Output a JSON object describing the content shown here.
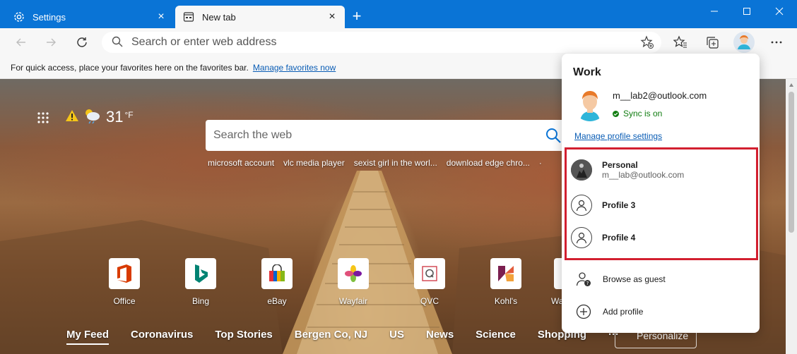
{
  "tabs": [
    {
      "label": "Settings",
      "icon": "gear-icon"
    },
    {
      "label": "New tab",
      "icon": "newtab-icon"
    }
  ],
  "address_bar": {
    "placeholder": "Search or enter web address"
  },
  "favorites_bar": {
    "message": "For quick access, place your favorites here on the favorites bar.",
    "link": "Manage favorites now"
  },
  "weather": {
    "temperature": "31",
    "unit": "°F"
  },
  "page_search": {
    "placeholder": "Search the web"
  },
  "suggestions": [
    "microsoft account",
    "vlc media player",
    "sexist girl in the worl...",
    "download edge chro...",
    "·"
  ],
  "tiles": [
    {
      "label": "Office",
      "color": "#d83b01"
    },
    {
      "label": "Bing",
      "color": "#008373"
    },
    {
      "label": "eBay",
      "color": "#e53238"
    },
    {
      "label": "Wayfair",
      "color": "#7b189f"
    },
    {
      "label": "QVC",
      "color": "#d1404c"
    },
    {
      "label": "Kohl's",
      "color": "#7b1f4f"
    },
    {
      "label": "Wa",
      "color": "#ffffff"
    }
  ],
  "feed_nav": [
    "My Feed",
    "Coronavirus",
    "Top Stories",
    "Bergen Co, NJ",
    "US",
    "News",
    "Science",
    "Shopping",
    "···"
  ],
  "personalize": "Personalize",
  "profile_flyout": {
    "title": "Work",
    "email": "m__lab2@outlook.com",
    "sync_status": "Sync is on",
    "manage_link": "Manage profile settings",
    "profiles": [
      {
        "name": "Personal",
        "email": "m__lab@outlook.com"
      },
      {
        "name": "Profile 3",
        "email": ""
      },
      {
        "name": "Profile 4",
        "email": ""
      }
    ],
    "actions": [
      {
        "label": "Browse as guest",
        "icon": "guest-icon"
      },
      {
        "label": "Add profile",
        "icon": "add-icon"
      }
    ]
  },
  "colors": {
    "titlebar": "#0a74d6",
    "highlight_box": "#d21f2f",
    "sync": "#107c10",
    "link": "#0a5db5"
  }
}
